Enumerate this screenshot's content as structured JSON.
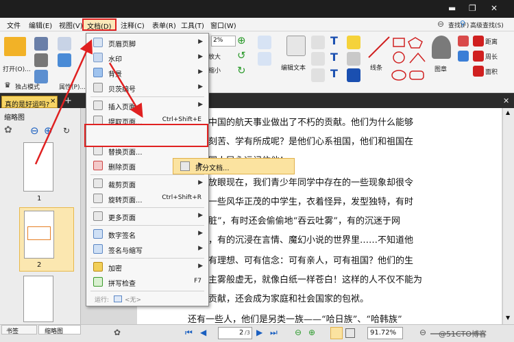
{
  "menubar": {
    "items": [
      "文件",
      "编辑(E)",
      "视图(V)",
      "文档(D)",
      "注释(C)",
      "表单(R)",
      "工具(T)",
      "窗口(W)"
    ]
  },
  "ribbon": {
    "open_label": "打开(O)...",
    "standalone_label": "独占模式",
    "properties_label": "属性(P)...",
    "zoom_value": "2%",
    "enlarge_label": "放大",
    "shrink_label": "缩小",
    "edit_text_label": "编辑文本",
    "line_label": "线条",
    "stamp_label": "图章",
    "distance_label": "距离",
    "perimeter_label": "周长",
    "area_label": "面积",
    "find_label": "查找(F)",
    "advanced_find_label": "高级查找(S)"
  },
  "doctab": {
    "title": "真的是好运吗?"
  },
  "leftpanel": {
    "title": "缩略图",
    "pages": [
      "1",
      "2"
    ]
  },
  "dropdown": {
    "items": [
      {
        "label": "页眉页脚",
        "shortcut": "",
        "arrow": "▶"
      },
      {
        "label": "水印",
        "shortcut": "",
        "arrow": "▶"
      },
      {
        "label": "背景",
        "shortcut": "",
        "arrow": "▶"
      },
      {
        "label": "贝茨编号",
        "shortcut": "",
        "arrow": "▶"
      },
      {
        "label": "插入页面",
        "shortcut": "",
        "arrow": "▶"
      },
      {
        "label": "提取页面...",
        "shortcut": "Ctrl+Shift+E",
        "arrow": ""
      },
      {
        "label": "拆分文档...",
        "shortcut": "",
        "arrow": ""
      },
      {
        "label": "替换页面...",
        "shortcut": "",
        "arrow": ""
      },
      {
        "label": "删除页面",
        "shortcut": "",
        "arrow": "▶"
      },
      {
        "label": "裁剪页面",
        "shortcut": "",
        "arrow": "▶"
      },
      {
        "label": "旋转页面...",
        "shortcut": "Ctrl+Shift+R",
        "arrow": ""
      },
      {
        "label": "更多页面",
        "shortcut": "",
        "arrow": "▶"
      },
      {
        "label": "数字签名",
        "shortcut": "",
        "arrow": "▶"
      },
      {
        "label": "签名与缩写",
        "shortcut": "",
        "arrow": "▶"
      },
      {
        "label": "加密",
        "shortcut": "",
        "arrow": "▶"
      },
      {
        "label": "拼写检查",
        "shortcut": "F7",
        "arrow": ""
      }
    ],
    "run_label": "运行:",
    "run_value": "<无>"
  },
  "document": {
    "lines": [
      "中国的航天事业做出了不朽的贡献。他们为什么能够",
      "刻苦、学有所成呢？是他们心系祖国，他们和祖国在",
      "国人民永远记住他！",
      "放眼现在，我们青少年同学中存在的一些现象却很令",
      "一些风华正茂的中学生，衣着怪异，发型独特，有时",
      "脏”，有时还会偷偷地“吞云吐雾”，有的沉迷于网",
      "，有的沉浸在言情、魔幻小说的世界里……不知道他",
      "有理想、可有信念：可有亲人，可有祖国？他们的生",
      "主雾般虚无，就像白纸一样苍白！这样的人不仅不能为",
      "贡献，还会成为家庭和社会国家的包袱。",
      "还有一些人，他们是另类一族——“哈日族”、“哈韩族”"
    ]
  },
  "bottombar": {
    "bookmark_tab": "书签",
    "thumbnail_tab": "缩略图",
    "page_input": "2",
    "page_total": "/3",
    "zoom_input": "91.72%",
    "watermark": "@51CTO博客"
  },
  "colors": {
    "highlight_red": "#e02020",
    "tab_gold": "#f7d565",
    "menu_hover": "#fbe3a0"
  }
}
